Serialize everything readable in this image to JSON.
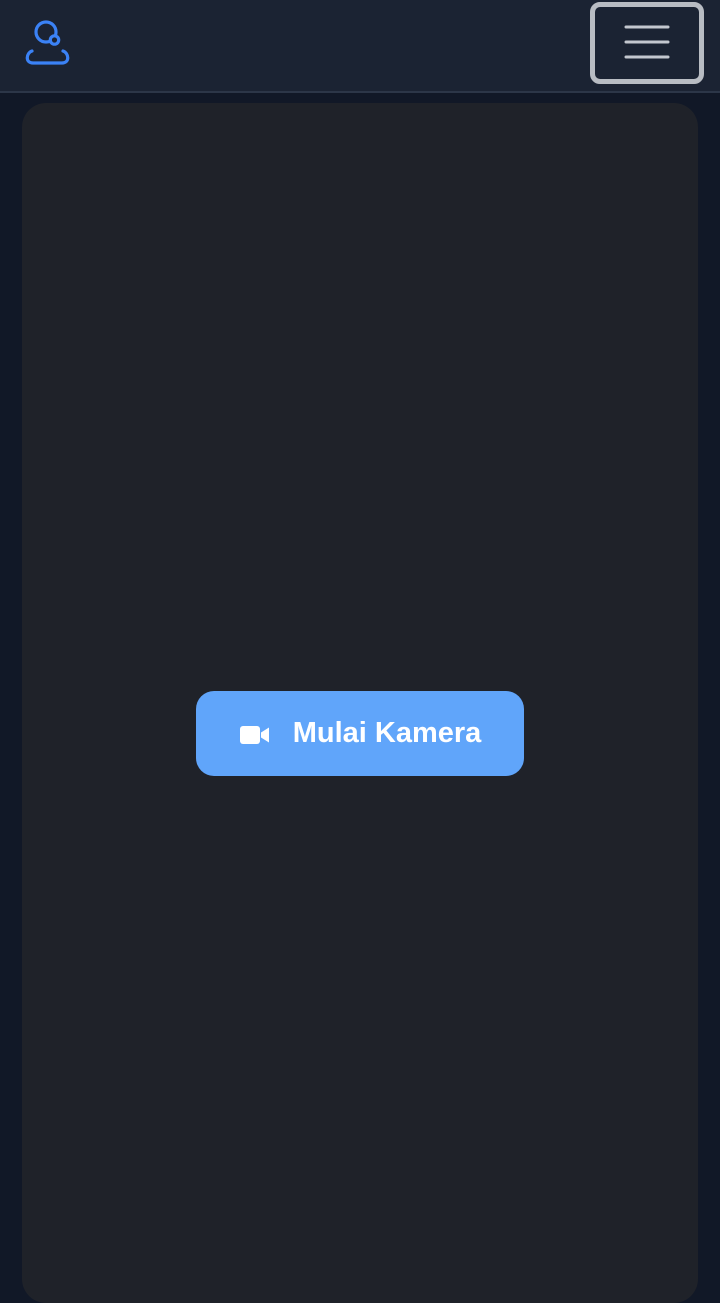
{
  "header": {
    "logo_icon": "user-location-icon",
    "menu_icon": "hamburger-menu-icon"
  },
  "camera": {
    "start_button_label": "Mulai Kamera",
    "start_button_icon": "video-camera-icon"
  },
  "colors": {
    "accent": "#60a5fa",
    "logo": "#3b82f6",
    "navbar_bg": "#1b2333",
    "page_bg": "#111827",
    "panel_bg": "#1f2229"
  }
}
